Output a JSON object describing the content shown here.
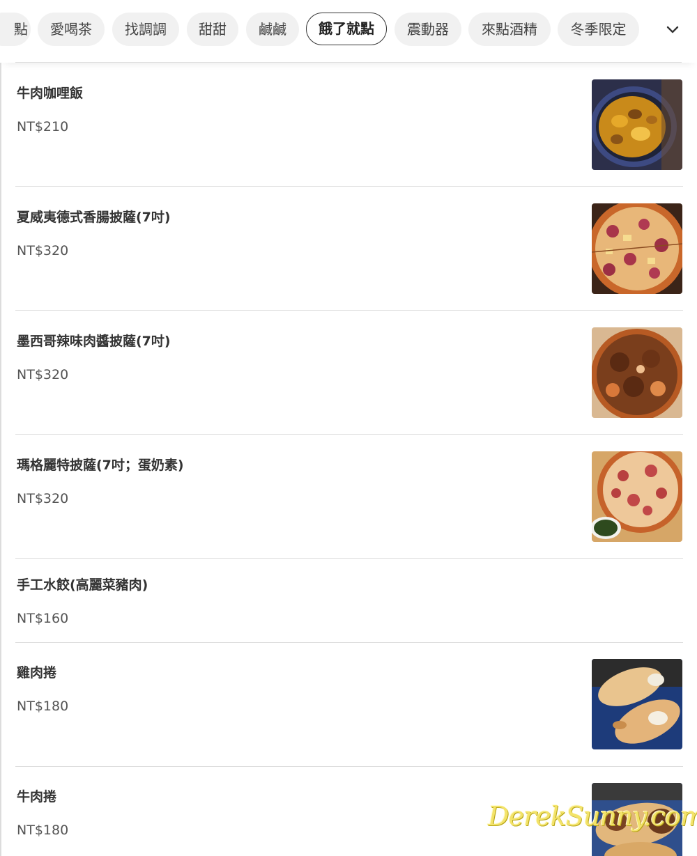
{
  "categories": [
    {
      "label": "點"
    },
    {
      "label": "愛喝茶"
    },
    {
      "label": "找調調"
    },
    {
      "label": "甜甜"
    },
    {
      "label": "鹹鹹"
    },
    {
      "label": "餓了就點"
    },
    {
      "label": "震動器"
    },
    {
      "label": "來點酒精"
    },
    {
      "label": "冬季限定"
    }
  ],
  "active_category": "餓了就點",
  "more_icon": "chevron-down-icon",
  "menu_items": [
    {
      "name": "牛肉咖哩飯",
      "price": "NT$210",
      "image": "beef-curry-rice-photo"
    },
    {
      "name": "夏威夷德式香腸披薩(7吋)",
      "price": "NT$320",
      "image": "hawaiian-sausage-pizza-photo"
    },
    {
      "name": "墨西哥辣味肉醬披薩(7吋)",
      "price": "NT$320",
      "image": "mexican-meat-sauce-pizza-photo"
    },
    {
      "name": "瑪格麗特披薩(7吋；蛋奶素)",
      "price": "NT$320",
      "image": "margherita-pizza-photo"
    },
    {
      "name": "手工水餃(高麗菜豬肉)",
      "price": "NT$160"
    },
    {
      "name": "雞肉捲",
      "price": "NT$180",
      "image": "chicken-wrap-photo"
    },
    {
      "name": "牛肉捲",
      "price": "NT$180",
      "image": "beef-wrap-photo"
    }
  ],
  "watermark": "DerekSunny.com",
  "colors": {
    "chip_bg": "#f1f1f1",
    "active_chip_border": "#333333",
    "divider": "#dedede",
    "watermark": "#f3e36a"
  }
}
